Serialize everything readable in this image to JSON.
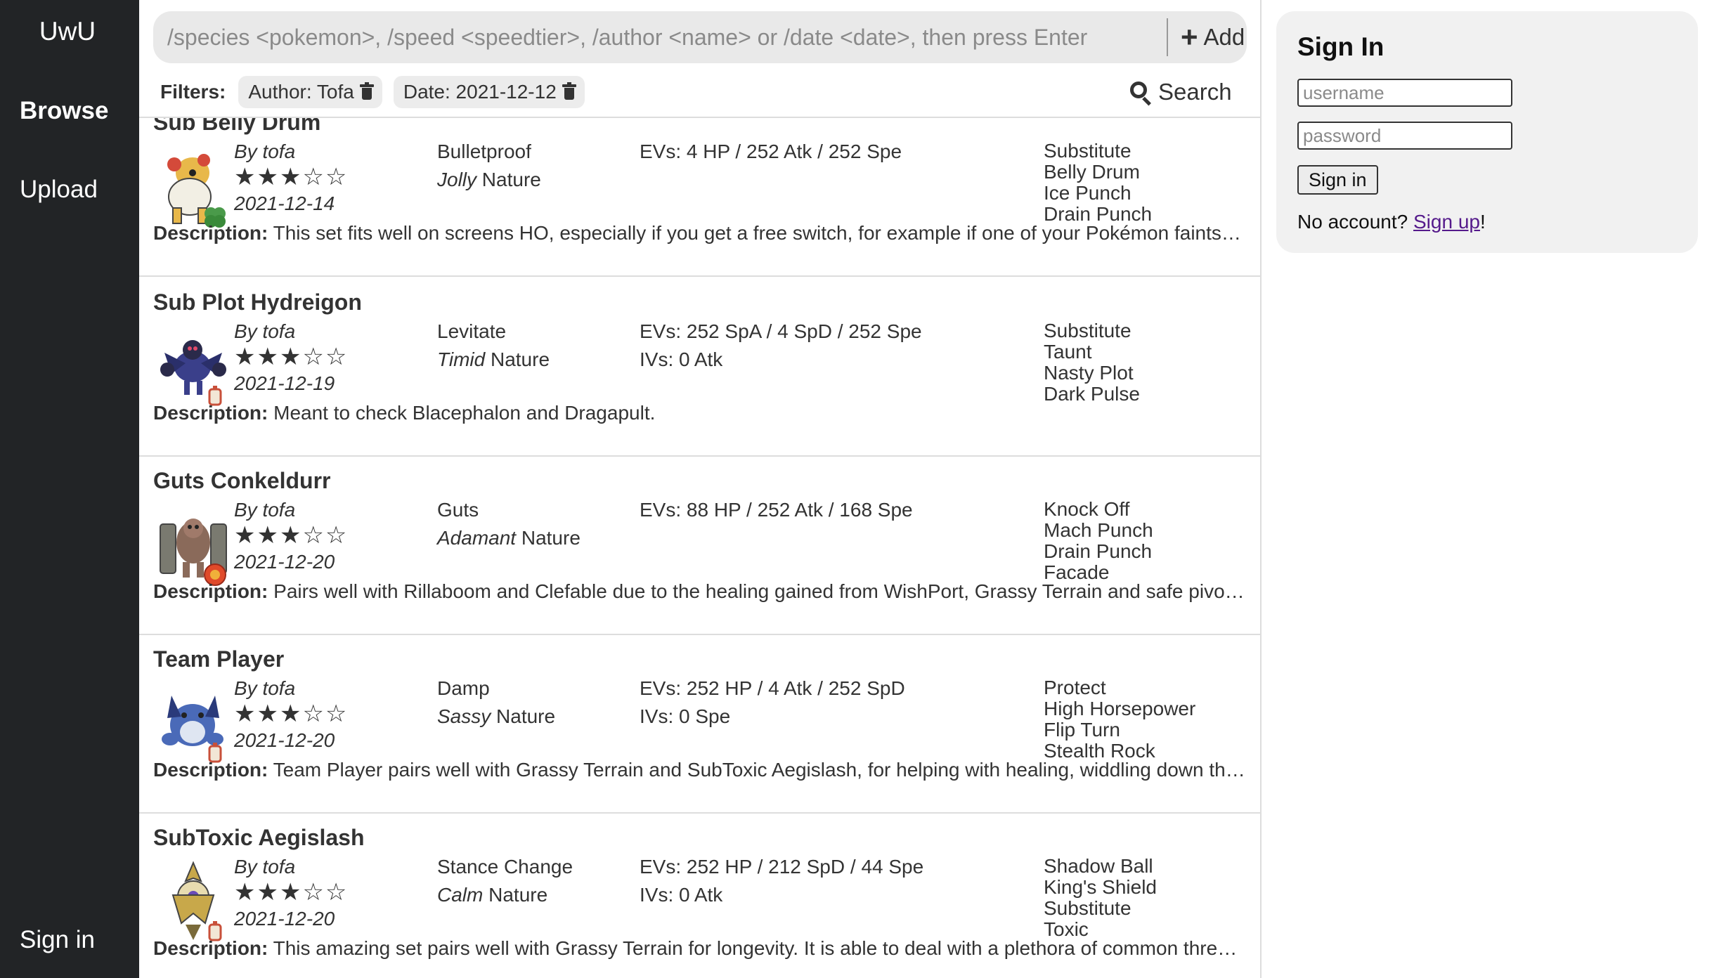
{
  "sidebar": {
    "brand": "UwU",
    "items": [
      {
        "label": "Browse"
      },
      {
        "label": "Upload"
      }
    ],
    "signin_label": "Sign in"
  },
  "topbar": {
    "command_placeholder": "/species <pokemon>, /speed <speedtier>, /author <name> or /date <date>, then press Enter",
    "add_label": "Add",
    "filters_label": "Filters:",
    "filters": [
      {
        "label": "Author: Tofa"
      },
      {
        "label": "Date: 2021-12-12"
      }
    ],
    "search_label": "Search"
  },
  "sets": [
    {
      "title": "Sub Belly Drum",
      "author": "By tofa",
      "rating": 3,
      "stars": "★★★☆☆",
      "date": "2021-12-14",
      "ability": "Bulletproof",
      "nature_name": "Jolly",
      "nature_suffix": " Nature",
      "evs": "EVs: 4 HP / 252 Atk / 252 Spe",
      "ivs": "",
      "moves": [
        "Substitute",
        "Belly Drum",
        "Ice Punch",
        "Drain Punch"
      ],
      "desc_label": "Description:",
      "description": " This set fits well on screens HO, especially if you get a free switch, for example if one of your Pokémon faints. Try it out!",
      "sprite_color": "#e8b84a",
      "item_color": "#4a9a4a"
    },
    {
      "title": "Sub Plot Hydreigon",
      "author": "By tofa",
      "rating": 3,
      "stars": "★★★☆☆",
      "date": "2021-12-19",
      "ability": "Levitate",
      "nature_name": "Timid",
      "nature_suffix": " Nature",
      "evs": "EVs: 252 SpA / 4 SpD / 252 Spe",
      "ivs": "IVs: 0 Atk",
      "moves": [
        "Substitute",
        "Taunt",
        "Nasty Plot",
        "Dark Pulse"
      ],
      "desc_label": "Description:",
      "description": " Meant to check Blacephalon and Dragapult.",
      "sprite_color": "#3a3f8a",
      "item_color": "#c8503a"
    },
    {
      "title": "Guts Conkeldurr",
      "author": "By tofa",
      "rating": 3,
      "stars": "★★★☆☆",
      "date": "2021-12-20",
      "ability": "Guts",
      "nature_name": "Adamant",
      "nature_suffix": " Nature",
      "evs": "EVs: 88 HP / 252 Atk / 168 Spe",
      "ivs": "",
      "moves": [
        "Knock Off",
        "Mach Punch",
        "Drain Punch",
        "Facade"
      ],
      "desc_label": "Description:",
      "description": " Pairs well with Rillaboom and Clefable due to the healing gained from WishPort, Grassy Terrain and safe pivoting.",
      "sprite_color": "#8a6a5a",
      "item_color": "#e04a2a"
    },
    {
      "title": "Team Player",
      "author": "By tofa",
      "rating": 3,
      "stars": "★★★☆☆",
      "date": "2021-12-20",
      "ability": "Damp",
      "nature_name": "Sassy",
      "nature_suffix": " Nature",
      "evs": "EVs: 252 HP / 4 Atk / 252 SpD",
      "ivs": "IVs: 0 Spe",
      "moves": [
        "Protect",
        "High Horsepower",
        "Flip Turn",
        "Stealth Rock"
      ],
      "desc_label": "Description:",
      "description": " Team Player pairs well with Grassy Terrain and SubToxic Aegislash, for helping with healing, widdling down the opponent's team and setting up hazards for the rest of the team.",
      "sprite_color": "#4a6ab8",
      "item_color": "#c8503a"
    },
    {
      "title": "SubToxic Aegislash",
      "author": "By tofa",
      "rating": 3,
      "stars": "★★★☆☆",
      "date": "2021-12-20",
      "ability": "Stance Change",
      "nature_name": "Calm",
      "nature_suffix": " Nature",
      "evs": "EVs: 252 HP / 212 SpD / 44 Spe",
      "ivs": "IVs: 0 Atk",
      "moves": [
        "Shadow Ball",
        "King's Shield",
        "Substitute",
        "Toxic"
      ],
      "desc_label": "Description:",
      "description": " This amazing set pairs well with Grassy Terrain for longevity. It is able to deal with a plethora of common threats if used correctly.",
      "sprite_color": "#c8a84a",
      "item_color": "#c8503a"
    }
  ],
  "signin": {
    "title": "Sign In",
    "username_placeholder": "username",
    "password_placeholder": "password",
    "button_label": "Sign in",
    "no_account_text": "No account? ",
    "signup_label": "Sign up",
    "after_text": "!"
  }
}
